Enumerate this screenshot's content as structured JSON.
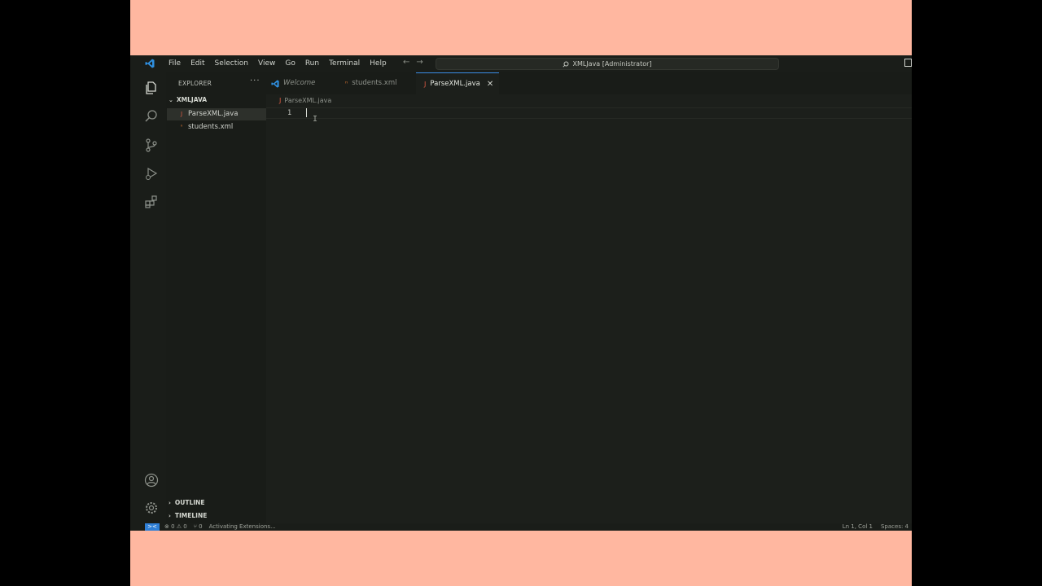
{
  "app": {
    "title": "XMLJava [Administrator]"
  },
  "menu": [
    "File",
    "Edit",
    "Selection",
    "View",
    "Go",
    "Run",
    "Terminal",
    "Help"
  ],
  "sidebar": {
    "title": "EXPLORER",
    "more": "···",
    "project": "XMLJAVA",
    "files": [
      {
        "name": "ParseXML.java",
        "icon": "java-icon",
        "active": true
      },
      {
        "name": "students.xml",
        "icon": "xml-icon",
        "active": false
      }
    ],
    "outline": "OUTLINE",
    "timeline": "TIMELINE"
  },
  "tabs": [
    {
      "label": "Welcome",
      "icon": "vscode-icon"
    },
    {
      "label": "students.xml",
      "icon": "xml-icon"
    },
    {
      "label": "ParseXML.java",
      "icon": "java-icon",
      "active": true,
      "close": "✕"
    }
  ],
  "breadcrumb": "ParseXML.java",
  "editor": {
    "line_number": "1",
    "ibeam": "I"
  },
  "status": {
    "remote": "><",
    "errors": "⊗ 0 ⚠ 0",
    "ports": "⑂ 0",
    "activity": "Activating Extensions...",
    "position": "Ln 1, Col 1",
    "spaces": "Spaces: 4"
  },
  "colors": {
    "accent": "#2f7fd6",
    "java": "#e05d44",
    "xml": "#e37933",
    "frame": "#ffb7a0"
  }
}
